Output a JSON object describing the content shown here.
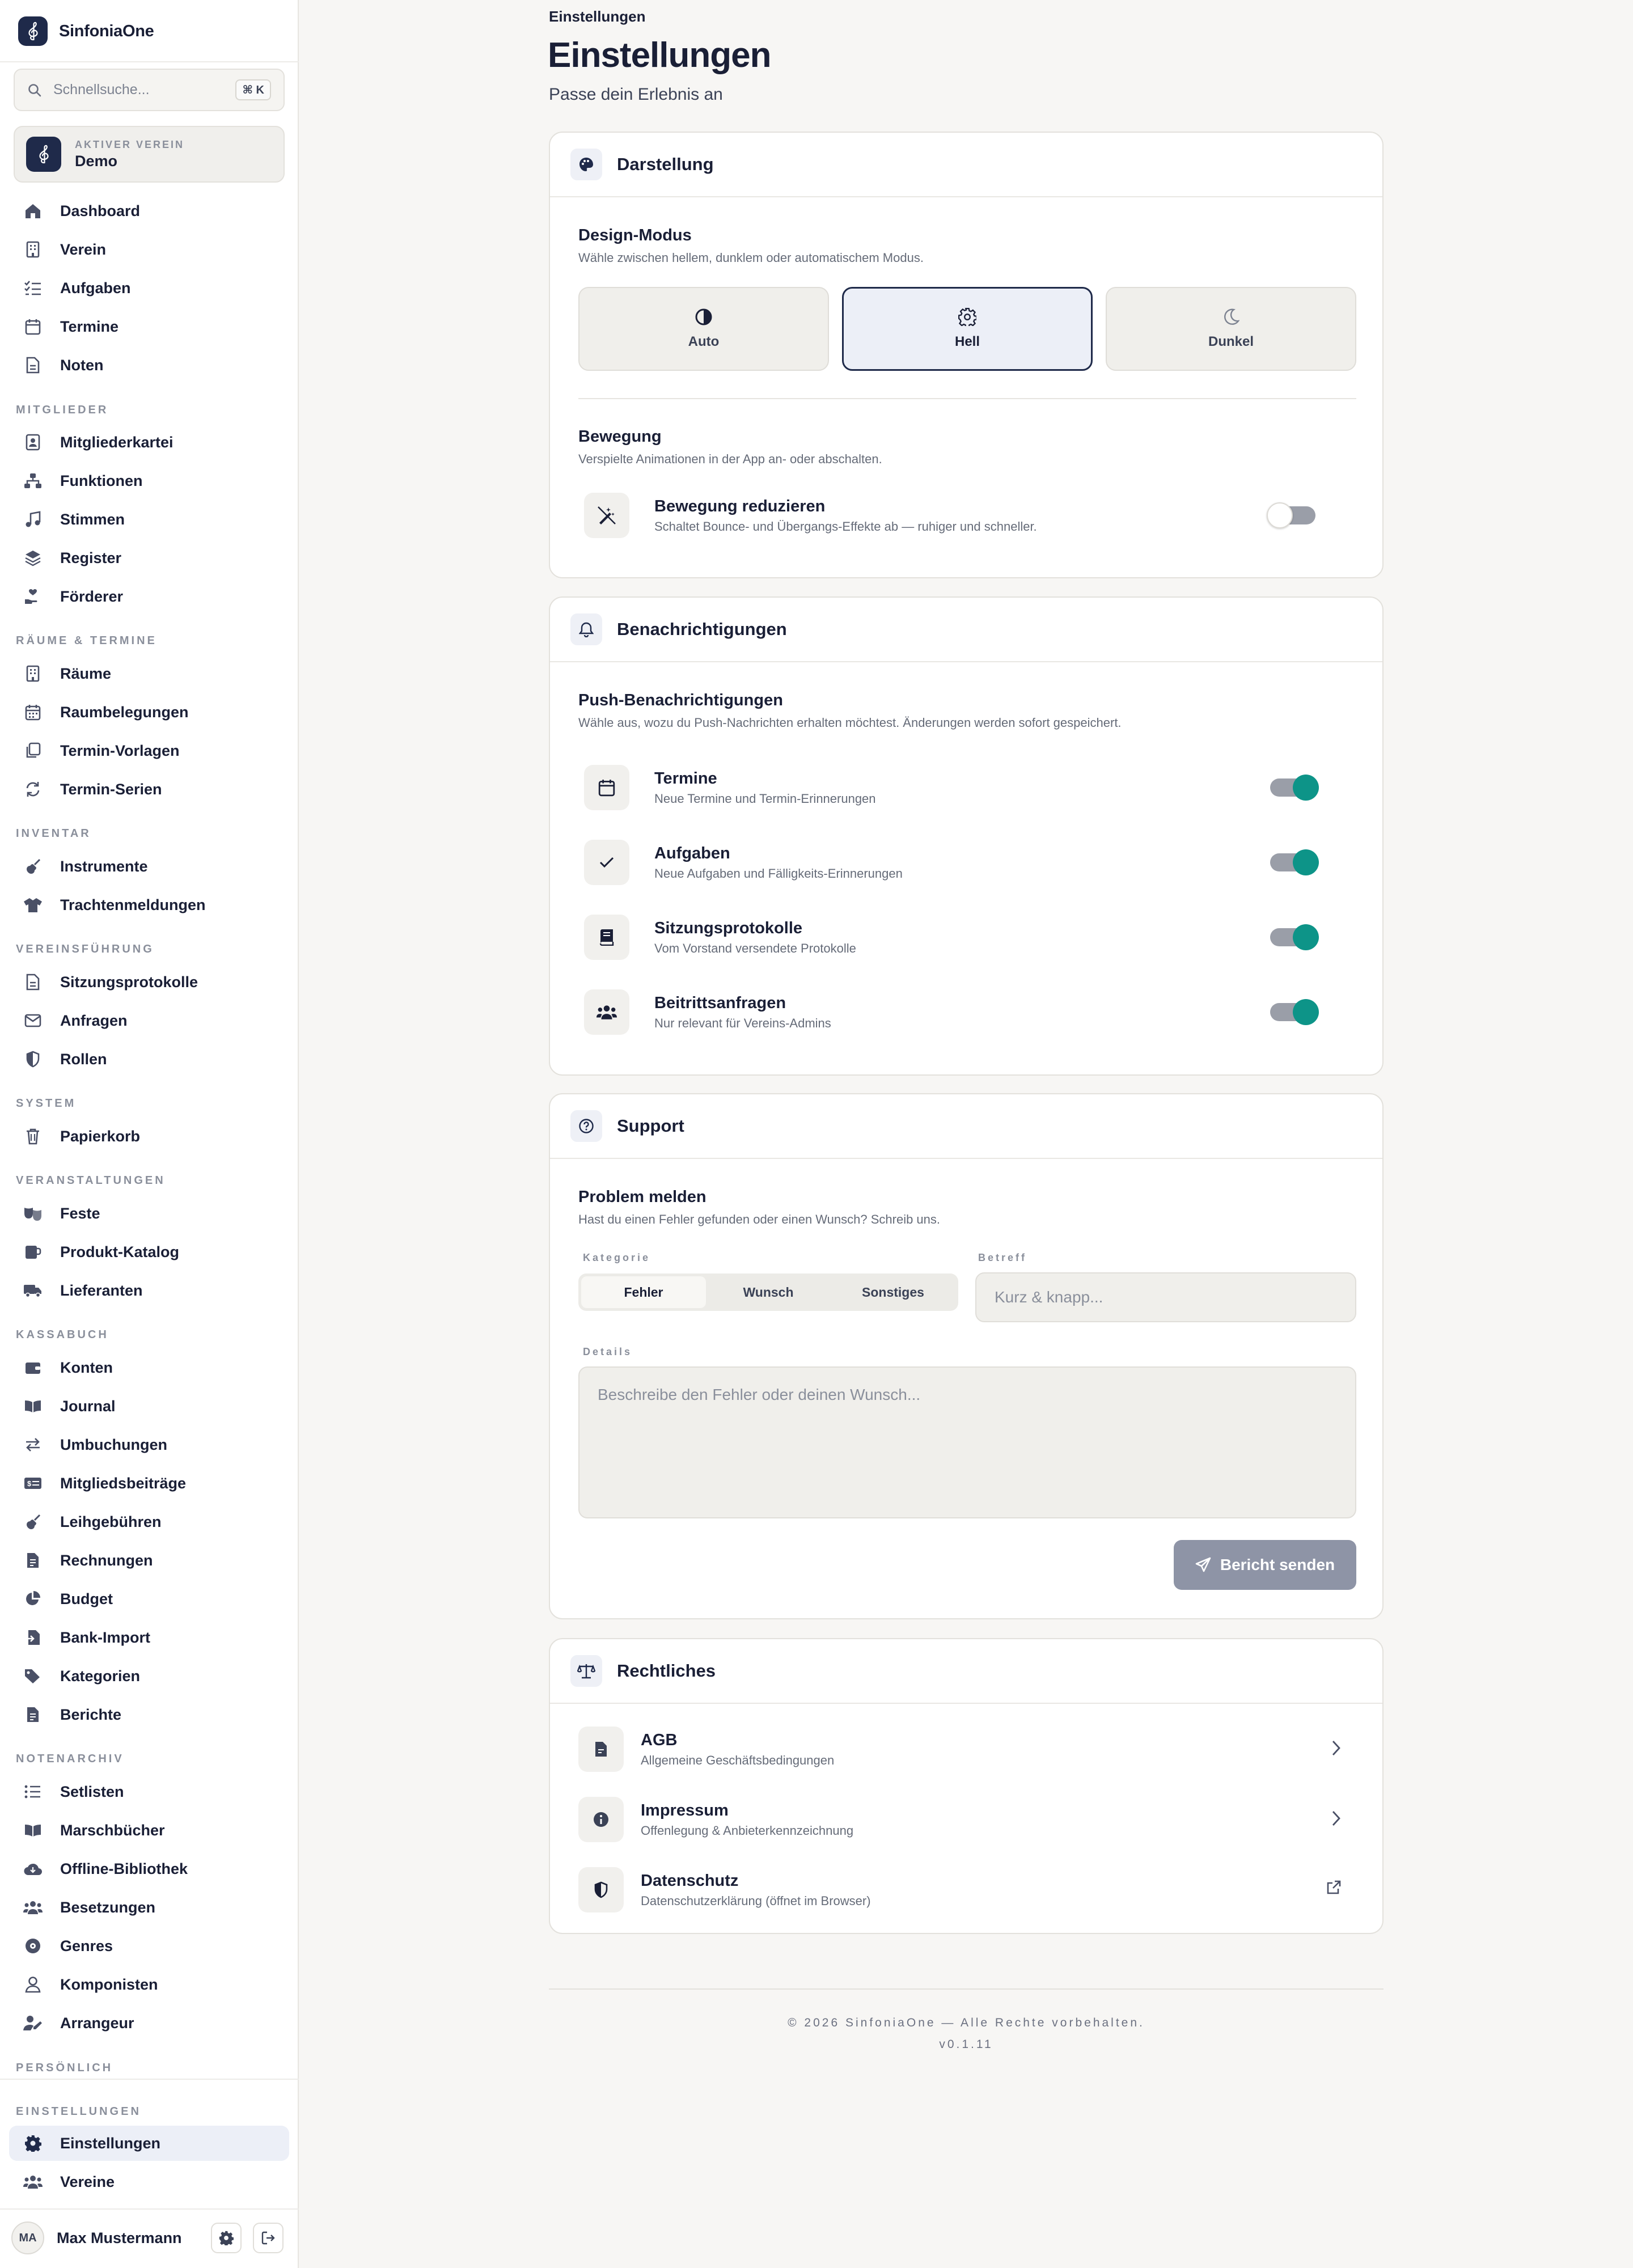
{
  "app": {
    "name": "SinfoniaOne"
  },
  "search": {
    "placeholder": "Schnellsuche...",
    "shortcut": "⌘ K"
  },
  "club": {
    "caption": "AKTIVER VEREIN",
    "name": "Demo"
  },
  "nav": {
    "top": [
      "Dashboard",
      "Verein",
      "Aufgaben",
      "Termine",
      "Noten"
    ],
    "sections": [
      {
        "title": "MITGLIEDER",
        "items": [
          "Mitgliederkartei",
          "Funktionen",
          "Stimmen",
          "Register",
          "Förderer"
        ]
      },
      {
        "title": "RÄUME & TERMINE",
        "items": [
          "Räume",
          "Raumbelegungen",
          "Termin-Vorlagen",
          "Termin-Serien"
        ]
      },
      {
        "title": "INVENTAR",
        "items": [
          "Instrumente",
          "Trachtenmeldungen"
        ]
      },
      {
        "title": "VEREINSFÜHRUNG",
        "items": [
          "Sitzungsprotokolle",
          "Anfragen",
          "Rollen"
        ]
      },
      {
        "title": "SYSTEM",
        "items": [
          "Papierkorb"
        ]
      },
      {
        "title": "VERANSTALTUNGEN",
        "items": [
          "Feste",
          "Produkt-Katalog",
          "Lieferanten"
        ]
      },
      {
        "title": "KASSABUCH",
        "items": [
          "Konten",
          "Journal",
          "Umbuchungen",
          "Mitgliedsbeiträge",
          "Leihgebühren",
          "Rechnungen",
          "Budget",
          "Bank-Import",
          "Kategorien",
          "Berichte"
        ]
      },
      {
        "title": "NOTENARCHIV",
        "items": [
          "Setlisten",
          "Marschbücher",
          "Offline-Bibliothek",
          "Besetzungen",
          "Genres",
          "Komponisten",
          "Arrangeur"
        ]
      },
      {
        "title": "PERSÖNLICH",
        "items": []
      },
      {
        "title": "EINSTELLUNGEN",
        "items": [
          "Einstellungen",
          "Vereine"
        ]
      }
    ],
    "active": "Einstellungen"
  },
  "user": {
    "initials": "MA",
    "name": "Max Mustermann"
  },
  "page": {
    "breadcrumb": "Einstellungen",
    "title": "Einstellungen",
    "subtitle": "Passe dein Erlebnis an"
  },
  "appearance": {
    "title": "Darstellung",
    "design_title": "Design-Modus",
    "design_desc": "Wähle zwischen hellem, dunklem oder automatischem Modus.",
    "modes": [
      "Auto",
      "Hell",
      "Dunkel"
    ],
    "selected_mode": "Hell",
    "motion_title": "Bewegung",
    "motion_desc": "Verspielte Animationen in der App an- oder abschalten.",
    "reduce_title": "Bewegung reduzieren",
    "reduce_desc": "Schaltet Bounce- und Übergangs-Effekte ab — ruhiger und schneller.",
    "reduce_on": false
  },
  "notifications": {
    "title": "Benachrichtigungen",
    "push_title": "Push-Benachrichtigungen",
    "push_desc": "Wähle aus, wozu du Push-Nachrichten erhalten möchtest. Änderungen werden sofort gespeichert.",
    "items": [
      {
        "title": "Termine",
        "desc": "Neue Termine und Termin-Erinnerungen",
        "on": true
      },
      {
        "title": "Aufgaben",
        "desc": "Neue Aufgaben und Fälligkeits-Erinnerungen",
        "on": true
      },
      {
        "title": "Sitzungsprotokolle",
        "desc": "Vom Vorstand versendete Protokolle",
        "on": true
      },
      {
        "title": "Beitrittsanfragen",
        "desc": "Nur relevant für Vereins-Admins",
        "on": true
      }
    ]
  },
  "support": {
    "title": "Support",
    "problem_title": "Problem melden",
    "problem_desc": "Hast du einen Fehler gefunden oder einen Wunsch? Schreib uns.",
    "category_label": "Kategorie",
    "categories": [
      "Fehler",
      "Wunsch",
      "Sonstiges"
    ],
    "selected_category": "Fehler",
    "subject_label": "Betreff",
    "subject_placeholder": "Kurz & knapp...",
    "details_label": "Details",
    "details_placeholder": "Beschreibe den Fehler oder deinen Wunsch...",
    "send_label": "Bericht senden"
  },
  "legal": {
    "title": "Rechtliches",
    "items": [
      {
        "title": "AGB",
        "desc": "Allgemeine Geschäftsbedingungen"
      },
      {
        "title": "Impressum",
        "desc": "Offenlegung & Anbieterkennzeichnung"
      },
      {
        "title": "Datenschutz",
        "desc": "Datenschutzerklärung (öffnet im Browser)"
      }
    ]
  },
  "footer": {
    "copyright": "© 2026 SinfoniaOne — Alle Rechte vorbehalten.",
    "version": "v0.1.11"
  },
  "colors": {
    "accent": "#1f2a4a",
    "toggle_on": "#0d9488",
    "selected_bg": "#eceff7",
    "background": "#f7f6f4"
  }
}
